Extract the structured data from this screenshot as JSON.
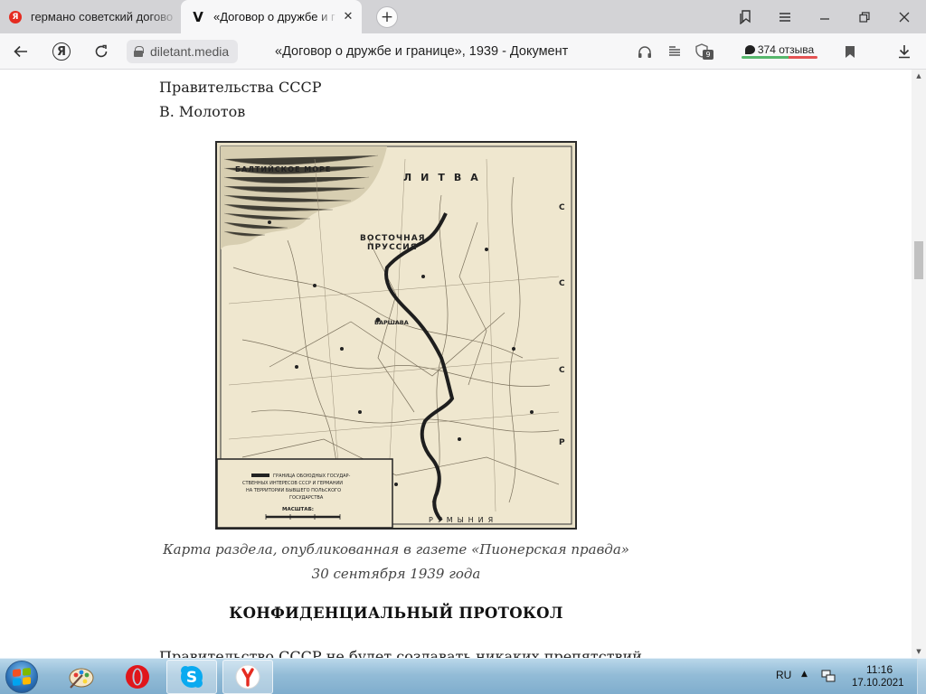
{
  "tabs": [
    {
      "title": "германо советский догово",
      "favicon": "Я",
      "active": false
    },
    {
      "title": "«Договор о дружбе и г",
      "favicon": "V",
      "active": true
    }
  ],
  "toolbar": {
    "url_domain": "diletant.media",
    "page_title": "«Договор о дружбе и границе», 1939 - Документ",
    "reviews_label": "374 отзыва",
    "extensions_badge": "9",
    "yandex_button_label": "Я",
    "colors": {
      "reviews_good": "#56b76c",
      "reviews_bad": "#e45252"
    }
  },
  "article": {
    "line_before_1": "Правительства СССР",
    "line_before_2": "В. Молотов",
    "map": {
      "sea_label": "БАЛТИЙСКОЕ МОРЕ",
      "region_label_1": "ВОСТОЧНАЯ",
      "region_label_2": "ПРУССИЯ",
      "country_label": "ЛИТВА",
      "capital_label": "ВАРШАВА",
      "bottom_label": "РУМЫНИЯ",
      "east_letters": [
        "С",
        "С",
        "С",
        "Р"
      ],
      "legend_lines": [
        "ГРАНИЦА ОБОЮДНЫХ ГОСУДАР-",
        "СТВЕННЫХ ИНТЕРЕСОВ СССР И ГЕРМАНИИ",
        "НА ТЕРРИТОРИИ БЫВШЕГО ПОЛЬСКОГО",
        "ГОСУДАРСТВА"
      ],
      "scale_title": "МАСШТАБ:"
    },
    "caption_line_1": "Карта раздела, опубликованная в газете «Пионерская правда»",
    "caption_line_2": "30 сентября 1939 года",
    "section_heading": "КОНФИДЕНЦИАЛЬНЫЙ ПРОТОКОЛ",
    "body_start": "Правительство СССР не будет создавать никаких препятствий"
  },
  "taskbar": {
    "language": "RU",
    "time": "11:16",
    "date": "17.10.2021"
  }
}
